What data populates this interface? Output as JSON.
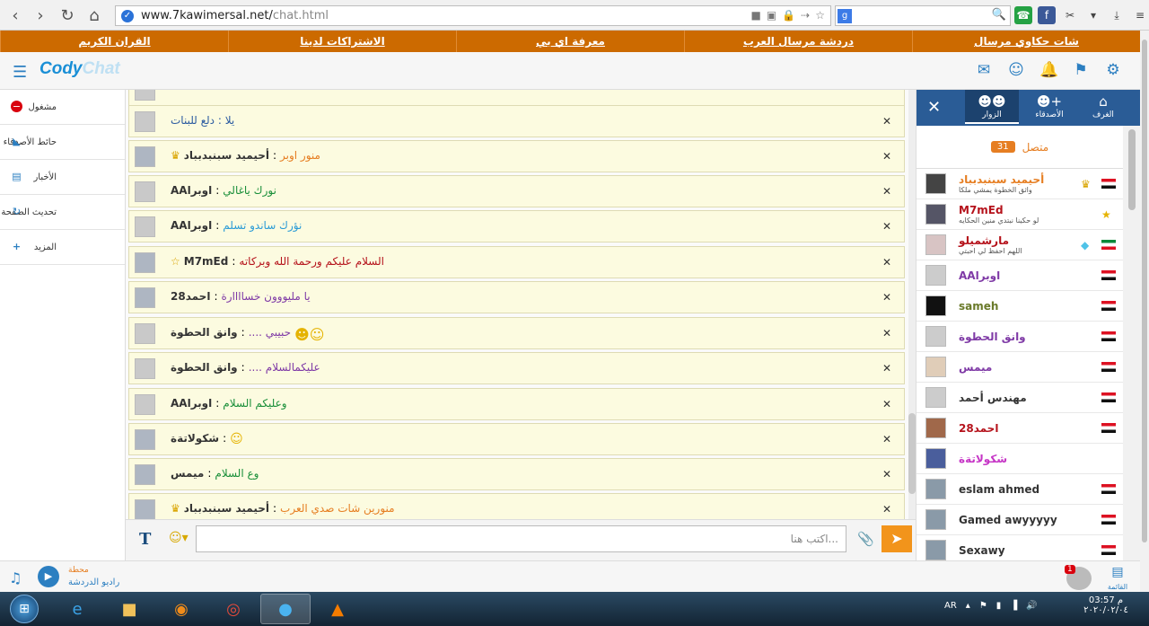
{
  "browser": {
    "url_host": "www.7kawimersal.net/",
    "url_path": "chat.html",
    "search_placeholder": ""
  },
  "top_menu": [
    "شات حكاوي مرسال",
    "دردشة مرسال العرب",
    "معرفة اي بي",
    "الاشتراكات لدينا",
    "القران الكريم"
  ],
  "logo": {
    "part1": "Cody",
    "part2": "Chat"
  },
  "left_menu": [
    {
      "label": "مشغول",
      "icon": "busy-icon"
    },
    {
      "label": "حائط الأصدقاء",
      "icon": "rss-icon"
    },
    {
      "label": "الأخبار",
      "icon": "news-icon"
    },
    {
      "label": "تحديث الصفحة",
      "icon": "refresh-icon"
    },
    {
      "label": "المزيد",
      "icon": "plus-icon"
    }
  ],
  "messages": [
    {
      "name": "",
      "text": "يلا : دلع للبنات",
      "color": "#2a5aa0",
      "avatar": "default"
    },
    {
      "name": "أحيميد سبنبدبباد",
      "text": "منور اوبر",
      "color": "#e67e22",
      "avatar": "photo",
      "badge": "crown"
    },
    {
      "name": "اوبراAA",
      "text": "نورك ياغالي",
      "color": "#1a8f3a",
      "avatar": "default"
    },
    {
      "name": "اوبراAA",
      "text": "نؤرك ساندو تسلم",
      "color": "#2a9bd6",
      "avatar": "default"
    },
    {
      "name": "M7mEd",
      "text": "السلام عليكم ورحمة الله وبركاته",
      "color": "#b5121b",
      "avatar": "photo",
      "badge": "star"
    },
    {
      "name": "احمد28",
      "text": "يا مليووون خساااارة",
      "color": "#7f3aa6",
      "avatar": "photo"
    },
    {
      "name": "وانق الحطوة",
      "text": "حبيبي ....",
      "color": "#7f3aa6",
      "avatar": "default"
    },
    {
      "name": "وانق الحطوة",
      "text": "عليكمالسلام ....",
      "color": "#7f3aa6",
      "avatar": "default"
    },
    {
      "name": "اوبراAA",
      "text": "وعليكم السلام",
      "color": "#1a8f3a",
      "avatar": "default"
    },
    {
      "name": "شكولاتةة",
      "text": "",
      "color": "#333333",
      "avatar": "photo"
    },
    {
      "name": "ميمس",
      "text": "وع السلام",
      "color": "#1a8f3a",
      "avatar": "photo"
    },
    {
      "name": "أحيميد سبنبدبباد",
      "text": "منورين شات صدي العرب",
      "color": "#e67e22",
      "avatar": "photo",
      "badge": "crown"
    }
  ],
  "input": {
    "placeholder": "...اكتب هنا"
  },
  "right_tabs": [
    {
      "label": "الزوار",
      "icon": "users-icon"
    },
    {
      "label": "الأصدقاء",
      "icon": "add-friend-icon"
    },
    {
      "label": "الغرف",
      "icon": "home-icon"
    }
  ],
  "online": {
    "label": "متصل",
    "count": "31"
  },
  "users": [
    {
      "name": "أحيميد سبنبدبباد",
      "mood": "واثق الخطوة يمشي ملكا",
      "color": "#e67e22",
      "badge": "crown",
      "flag": "eg",
      "avatar": "photo"
    },
    {
      "name": "M7mEd",
      "mood": "لو حكينا نبتدي منين الحكايه",
      "color": "#b5121b",
      "badge": "star",
      "flag": "",
      "avatar": "photo"
    },
    {
      "name": "مارشميلو",
      "mood": "اللهم احفظ لي احبتي",
      "color": "#b5121b",
      "badge": "diamond",
      "flag": "kw",
      "avatar": "photo"
    },
    {
      "name": "اوبراAA",
      "mood": "",
      "color": "#7f3aa6",
      "badge": "",
      "flag": "eg",
      "avatar": "default"
    },
    {
      "name": "sameh",
      "mood": "",
      "color": "#6a7a2a",
      "badge": "",
      "flag": "eg",
      "avatar": "photo"
    },
    {
      "name": "وانق الحطوة",
      "mood": "",
      "color": "#7f3aa6",
      "badge": "",
      "flag": "eg",
      "avatar": "default"
    },
    {
      "name": "ميمس",
      "mood": "",
      "color": "#7f3aa6",
      "badge": "",
      "flag": "eg",
      "avatar": "photo"
    },
    {
      "name": "مهندس أحمد",
      "mood": "",
      "color": "#333333",
      "badge": "",
      "flag": "eg",
      "avatar": "default"
    },
    {
      "name": "احمد28",
      "mood": "",
      "color": "#b5121b",
      "badge": "",
      "flag": "eg",
      "avatar": "photo"
    },
    {
      "name": "شكولاتةة",
      "mood": "",
      "color": "#c636c6",
      "badge": "",
      "flag": "",
      "avatar": "photo"
    },
    {
      "name": "eslam ahmed",
      "mood": "",
      "color": "#333333",
      "badge": "",
      "flag": "eg",
      "avatar": "gray"
    },
    {
      "name": "Gamed awyyyyy",
      "mood": "",
      "color": "#333333",
      "badge": "",
      "flag": "eg",
      "avatar": "gray"
    },
    {
      "name": "Sexawy",
      "mood": "",
      "color": "#333333",
      "badge": "",
      "flag": "eg",
      "avatar": "gray"
    }
  ],
  "radio": {
    "title": "محطة",
    "name": "راديو الدردشة"
  },
  "notif": {
    "count": "1"
  },
  "list_label": "القائمة",
  "taskbar": {
    "lang": "AR",
    "time": "03:57 م",
    "date": "٢٠٢٠/٠٢/٠٤"
  },
  "colors": {
    "orange": "#cc6a00",
    "blue": "#2a5c96",
    "accent": "#2c7fc1"
  }
}
